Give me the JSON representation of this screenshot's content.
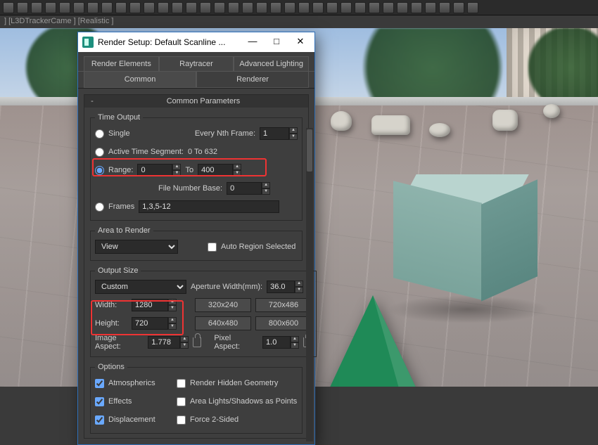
{
  "viewport_labels": "] [L3DTrackerCame ] [Realistic ]",
  "dialog": {
    "title": "Render Setup: Default Scanline ...",
    "win_min": "—",
    "win_max": "□",
    "win_close": "✕",
    "tabs_upper": {
      "t1": "Render Elements",
      "t2": "Raytracer",
      "t3": "Advanced Lighting"
    },
    "tabs_lower": {
      "t1": "Common",
      "t2": "Renderer"
    },
    "common_params_title": "Common Parameters",
    "pm": "-",
    "time_output": {
      "legend": "Time Output",
      "single": "Single",
      "every_nth_label": "Every Nth Frame:",
      "every_nth": "1",
      "active_segment": "Active Time Segment:",
      "active_range": "0 To 632",
      "range_label": "Range:",
      "range_from": "0",
      "range_to_label": "To",
      "range_to": "400",
      "file_num_base_label": "File Number Base:",
      "file_num_base": "0",
      "frames_label": "Frames",
      "frames_value": "1,3,5-12"
    },
    "area": {
      "legend": "Area to Render",
      "mode": "View",
      "auto_region": "Auto Region Selected"
    },
    "output": {
      "legend": "Output Size",
      "preset": "Custom",
      "aperture_label": "Aperture Width(mm):",
      "aperture": "36.0",
      "width_label": "Width:",
      "width": "1280",
      "height_label": "Height:",
      "height": "720",
      "presets": {
        "p1": "320x240",
        "p2": "720x486",
        "p3": "640x480",
        "p4": "800x600"
      },
      "image_aspect_label": "Image Aspect:",
      "image_aspect": "1.778",
      "pixel_aspect_label": "Pixel Aspect:",
      "pixel_aspect": "1.0"
    },
    "options": {
      "legend": "Options",
      "atmospherics": "Atmospherics",
      "render_hidden": "Render Hidden Geometry",
      "effects": "Effects",
      "area_lights": "Area Lights/Shadows as Points",
      "displacement": "Displacement",
      "force_2sided": "Force 2-Sided"
    }
  }
}
